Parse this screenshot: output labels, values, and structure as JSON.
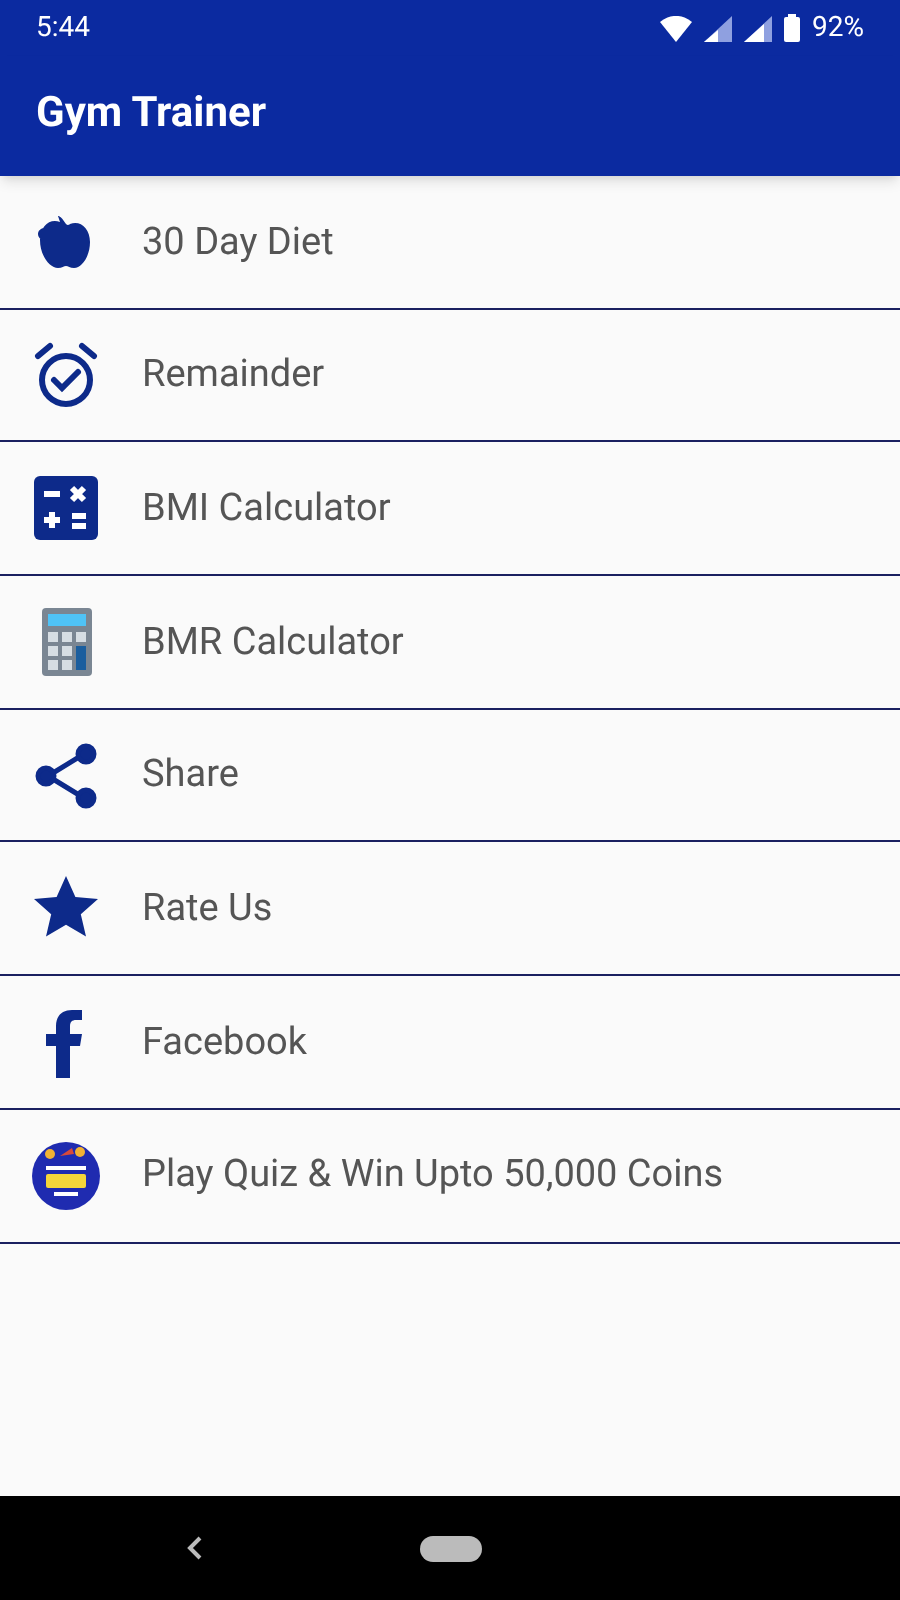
{
  "status_bar": {
    "time": "5:44",
    "battery": "92%"
  },
  "app_bar": {
    "title": "Gym Trainer"
  },
  "menu": [
    {
      "kind": "apple",
      "label": "30 Day Diet"
    },
    {
      "kind": "alarm",
      "label": "Remainder"
    },
    {
      "kind": "operators",
      "label": "BMI Calculator"
    },
    {
      "kind": "calculator",
      "label": "BMR Calculator"
    },
    {
      "kind": "share",
      "label": "Share"
    },
    {
      "kind": "star",
      "label": "Rate Us"
    },
    {
      "kind": "facebook",
      "label": "Facebook"
    },
    {
      "kind": "coin-badge",
      "label": "Play Quiz & Win Upto 50,000 Coins"
    }
  ]
}
